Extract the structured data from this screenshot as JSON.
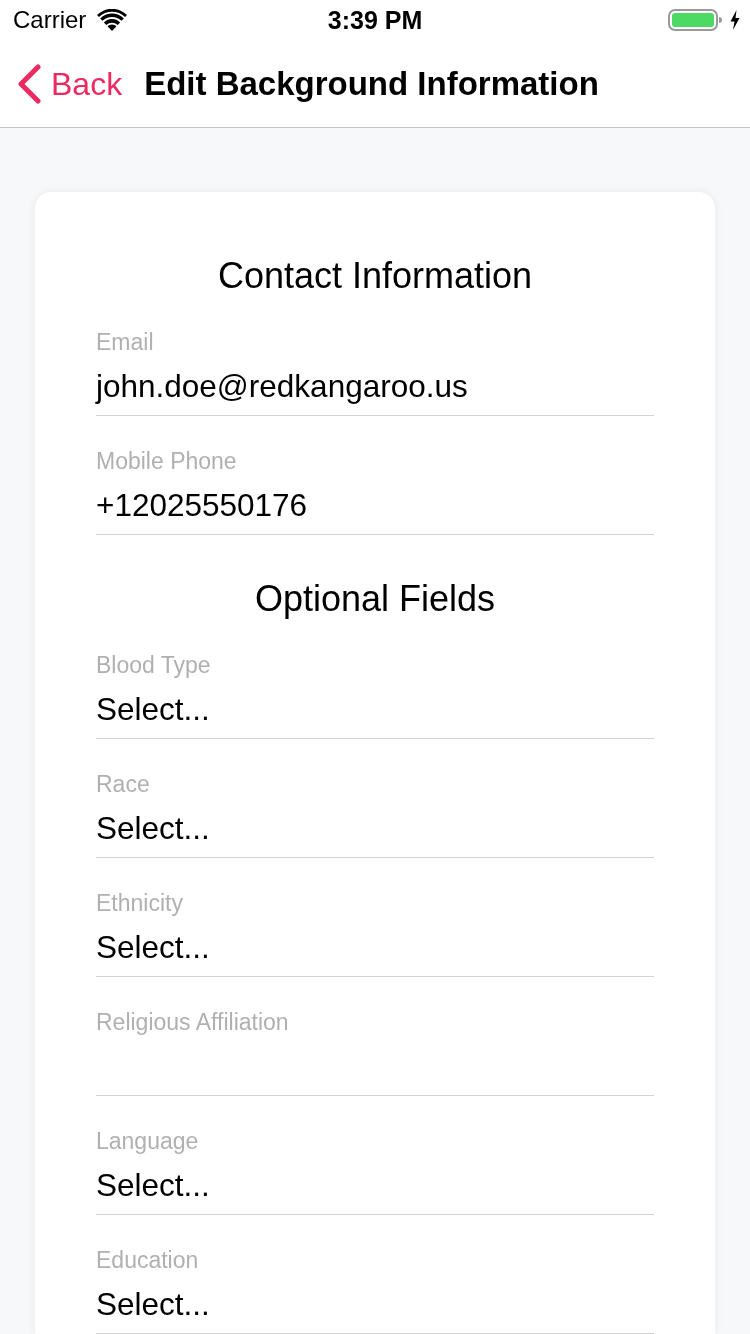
{
  "status_bar": {
    "carrier": "Carrier",
    "time": "3:39 PM"
  },
  "nav_bar": {
    "back_label": "Back",
    "title": "Edit Background Information"
  },
  "sections": [
    {
      "title": "Contact Information",
      "fields": [
        {
          "label": "Email",
          "value": "john.doe@redkangaroo.us"
        },
        {
          "label": "Mobile Phone",
          "value": "+12025550176"
        }
      ]
    },
    {
      "title": "Optional Fields",
      "fields": [
        {
          "label": "Blood Type",
          "value": "Select..."
        },
        {
          "label": "Race",
          "value": "Select..."
        },
        {
          "label": "Ethnicity",
          "value": "Select..."
        },
        {
          "label": "Religious Affiliation"
        },
        {
          "label": "Language",
          "value": "Select..."
        },
        {
          "label": "Education",
          "value": "Select..."
        }
      ]
    }
  ]
}
